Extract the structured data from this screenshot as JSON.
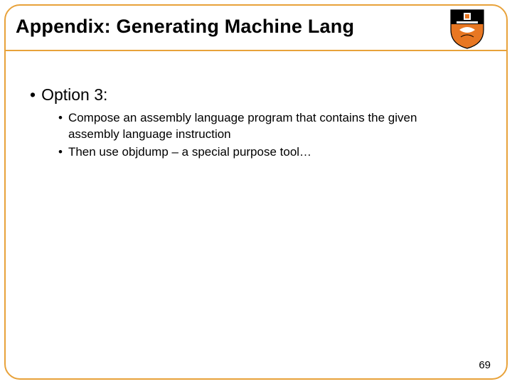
{
  "slide": {
    "title": "Appendix: Generating Machine Lang",
    "option": {
      "label": "Option 3:"
    },
    "sub": [
      "Compose an assembly language program that contains the given assembly language instruction",
      "Then use objdump – a special purpose tool…"
    ],
    "pagenum": "69"
  }
}
